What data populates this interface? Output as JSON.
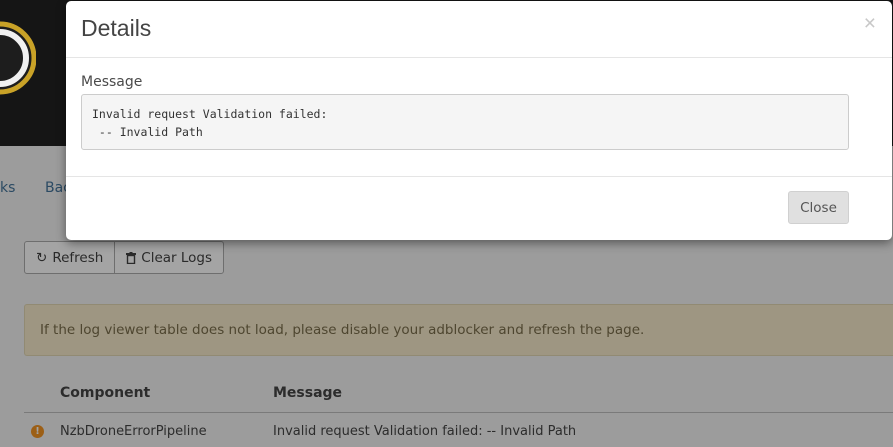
{
  "background": {
    "tabs": [
      "ks",
      "Bac"
    ],
    "toolbar": {
      "refresh_label": "Refresh",
      "refresh_icon": "refresh-icon",
      "clear_label": "Clear Logs",
      "clear_icon": "trash-icon"
    },
    "alert_text": "If the log viewer table does not load, please disable your adblocker and refresh the page.",
    "table": {
      "columns": [
        "Component",
        "Message"
      ],
      "rows": [
        {
          "level_icon": "warning-icon",
          "component": "NzbDroneErrorPipeline",
          "message": "Invalid request Validation failed:  -- Invalid Path"
        }
      ]
    }
  },
  "modal": {
    "title": "Details",
    "close_glyph": "×",
    "field_label": "Message",
    "message": "Invalid request Validation failed:\n -- Invalid Path",
    "close_button": "Close"
  }
}
